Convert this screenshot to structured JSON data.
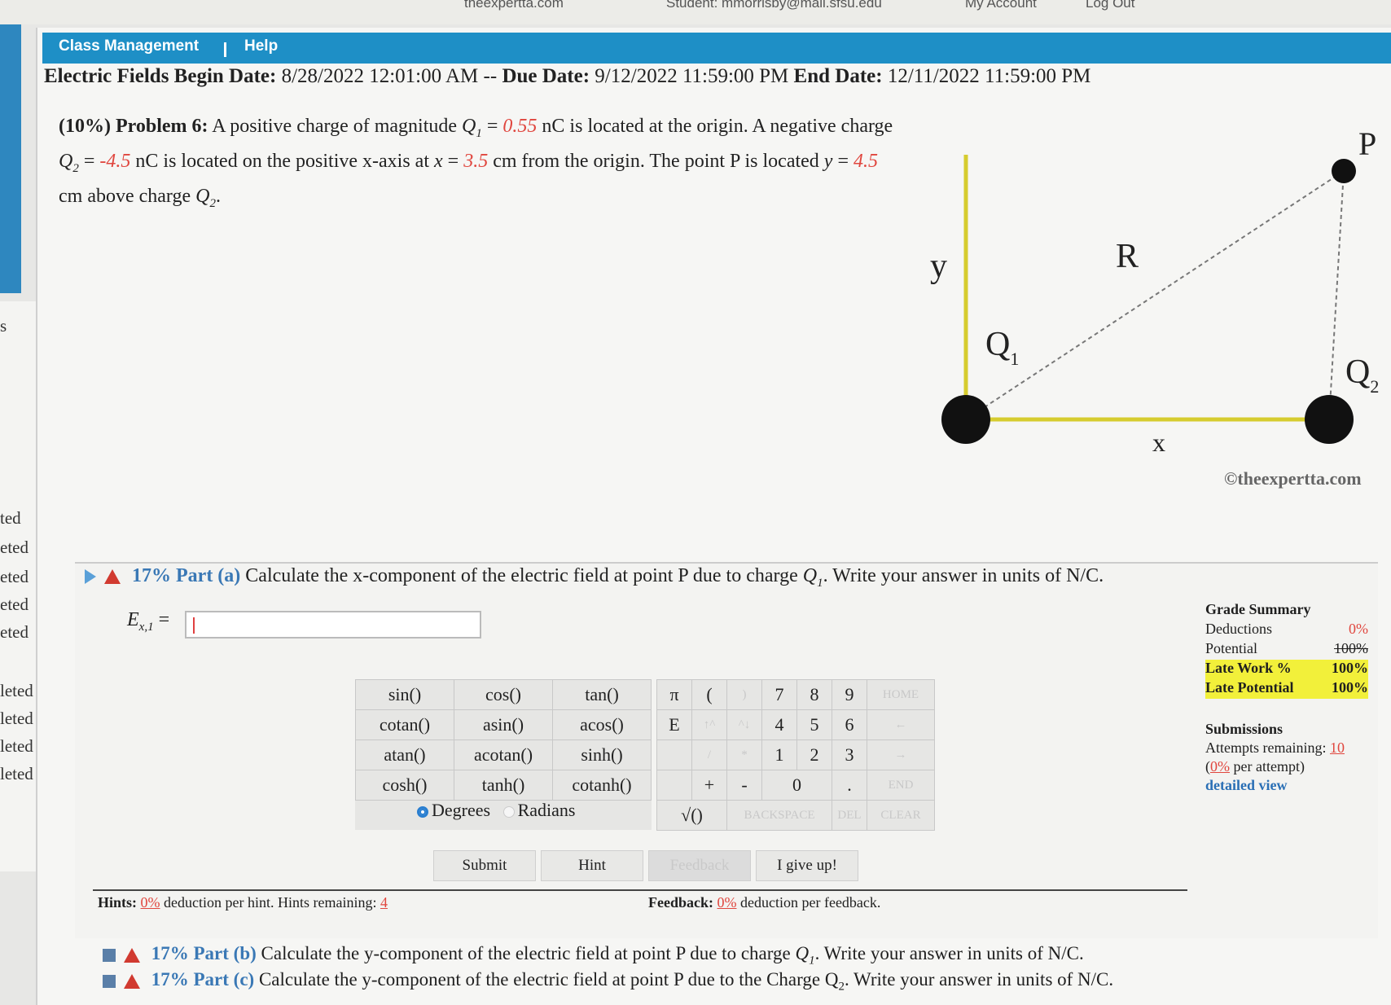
{
  "top_links": {
    "site": "theexpertta.com",
    "student": "Student: mmorrisby@mail.sfsu.edu",
    "account": "My Account",
    "logout": "Log Out"
  },
  "left_sidebar": {
    "items": [
      "s",
      "ted",
      "eted",
      "eted",
      "eted",
      "eted",
      "leted",
      "leted",
      "leted",
      "leted"
    ]
  },
  "nav": {
    "class_management": "Class Management",
    "help": "Help"
  },
  "header": {
    "assignment": "Electric Fields",
    "begin_label": "Begin Date:",
    "begin": "8/28/2022 12:01:00 AM",
    "sep": "--",
    "due_label": "Due Date:",
    "due": "9/12/2022 11:59:00 PM",
    "end_label": "End Date:",
    "end": "12/11/2022 11:59:00 PM"
  },
  "problem": {
    "weight": "(10%)",
    "label": "Problem 6:",
    "t1": "A positive charge of magnitude",
    "q1_sym": "Q",
    "q1_sub": "1",
    "eq": "=",
    "q1_val": "0.55",
    "t2": "nC is located at the origin. A negative charge",
    "q2_sym": "Q",
    "q2_sub": "2",
    "q2_val": "-4.5",
    "t3": "nC is located on the positive x-axis at",
    "x_sym": "x",
    "x_val": "3.5",
    "t4": "cm from the origin. The point P is located",
    "y_sym": "y",
    "y_val": "4.5",
    "t5": "cm above charge",
    "t6": "Q",
    "t6_sub": "2",
    "t7": "."
  },
  "diagram": {
    "P": "P",
    "y": "y",
    "R": "R",
    "Q1": "Q",
    "Q1_sub": "1",
    "Q2": "Q",
    "Q2_sub": "2",
    "x": "x",
    "copyright": "©theexpertta.com",
    "colors": {
      "axis": "#d6cc2f",
      "charge": "#111111"
    }
  },
  "part_a": {
    "pct": "17%",
    "label": "Part (a)",
    "text": "Calculate the x-component of the electric field at point P due to charge",
    "q": "Q",
    "q_sub": "1",
    "text2": ". Write your answer in units of N/C.",
    "answer_label": "E",
    "answer_sub": "x,1",
    "answer_eq": "=",
    "answer_value": ""
  },
  "functions": [
    [
      "sin()",
      "cos()",
      "tan()"
    ],
    [
      "cotan()",
      "asin()",
      "acos()"
    ],
    [
      "atan()",
      "acotan()",
      "sinh()"
    ],
    [
      "cosh()",
      "tanh()",
      "cotanh()"
    ]
  ],
  "angle_mode": {
    "degrees": "Degrees",
    "radians": "Radians",
    "selected": "Degrees"
  },
  "keypad": {
    "r1": [
      "π",
      "(",
      ")",
      "7",
      "8",
      "9",
      "HOME"
    ],
    "r2": [
      "E",
      "↑^",
      "^↓",
      "4",
      "5",
      "6",
      "←"
    ],
    "r3": [
      "",
      "/",
      "*",
      "1",
      "2",
      "3",
      "→"
    ],
    "r4": [
      "",
      "+",
      "-",
      "0",
      ".",
      "END"
    ],
    "r5": [
      "√()",
      "BACKSPACE",
      "DEL",
      "CLEAR"
    ]
  },
  "buttons": {
    "submit": "Submit",
    "hint": "Hint",
    "feedback": "Feedback",
    "give_up": "I give up!"
  },
  "hints": {
    "label": "Hints:",
    "pct": "0%",
    "text": "deduction per hint. Hints remaining:",
    "remaining": "4",
    "fb_label": "Feedback:",
    "fb_pct": "0%",
    "fb_text": "deduction per feedback."
  },
  "grade_summary": {
    "title": "Grade Summary",
    "deductions_label": "Deductions",
    "deductions": "0%",
    "potential_label": "Potential",
    "potential": "100%",
    "late_work_label": "Late Work %",
    "late_work": "100%",
    "late_potential_label": "Late Potential",
    "late_potential": "100%"
  },
  "submissions": {
    "title": "Submissions",
    "attempts_label": "Attempts remaining:",
    "attempts": "10",
    "pct": "0%",
    "per_attempt": "per attempt)",
    "open": "(",
    "detailed": "detailed view"
  },
  "part_b": {
    "pct": "17%",
    "label": "Part (b)",
    "text": "Calculate the y-component of the electric field at point P due to charge",
    "q": "Q",
    "q_sub": "1",
    "text2": ". Write your answer in units of N/C."
  },
  "part_c": {
    "pct": "17%",
    "label": "Part (c)",
    "text": "Calculate the y-component of the electric field at point P due to the Charge Q",
    "q_sub": "2",
    "text2": ". Write your answer in units of N/C."
  }
}
